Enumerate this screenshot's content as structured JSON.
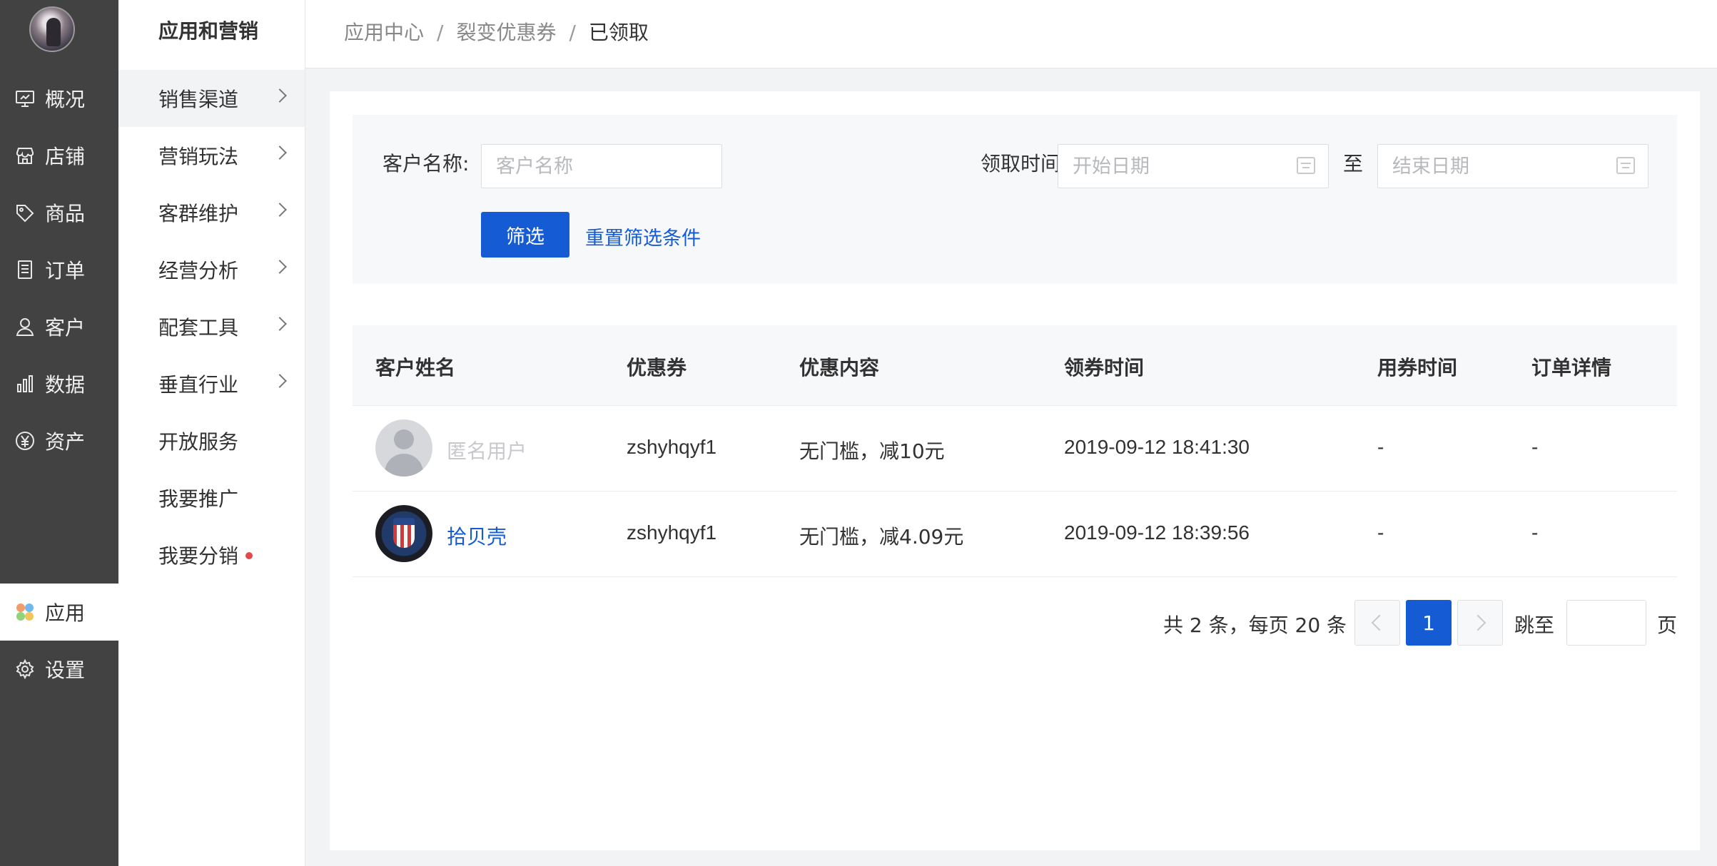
{
  "nav_primary": {
    "items": [
      {
        "label": "概况",
        "icon": "dashboard-icon"
      },
      {
        "label": "店铺",
        "icon": "store-icon"
      },
      {
        "label": "商品",
        "icon": "tag-icon"
      },
      {
        "label": "订单",
        "icon": "order-icon"
      },
      {
        "label": "客户",
        "icon": "user-icon"
      },
      {
        "label": "数据",
        "icon": "bar-chart-icon"
      },
      {
        "label": "资产",
        "icon": "yuan-icon"
      },
      {
        "label": "应用",
        "icon": "apps-icon"
      },
      {
        "label": "设置",
        "icon": "gear-icon"
      }
    ],
    "active": "应用"
  },
  "nav_secondary": {
    "title": "应用和营销",
    "items": [
      {
        "label": "销售渠道",
        "has_children": true
      },
      {
        "label": "营销玩法",
        "has_children": true
      },
      {
        "label": "客群维护",
        "has_children": true
      },
      {
        "label": "经营分析",
        "has_children": true
      },
      {
        "label": "配套工具",
        "has_children": true
      },
      {
        "label": "垂直行业",
        "has_children": true
      },
      {
        "label": "开放服务",
        "has_children": false
      },
      {
        "label": "我要推广",
        "has_children": false
      },
      {
        "label": "我要分销",
        "has_children": false,
        "badge_dot": true
      }
    ]
  },
  "breadcrumb": {
    "items": [
      "应用中心",
      "裂变优惠券",
      "已领取"
    ],
    "separator": "/"
  },
  "filter": {
    "customer_name_label": "客户名称:",
    "customer_name_placeholder": "客户名称",
    "customer_name_value": "",
    "receive_time_label": "领取时间:",
    "start_date_placeholder": "开始日期",
    "end_date_placeholder": "结束日期",
    "to_label": "至",
    "filter_button": "筛选",
    "reset_link": "重置筛选条件"
  },
  "table": {
    "columns": [
      "客户姓名",
      "优惠券",
      "优惠内容",
      "领券时间",
      "用券时间",
      "订单详情"
    ],
    "rows": [
      {
        "name": "匿名用户",
        "anonymous": true,
        "coupon": "zshyhqyf1",
        "content": "无门槛，减10元",
        "receive_time": "2019-09-12 18:41:30",
        "use_time": "-",
        "order_detail": "-"
      },
      {
        "name": "拾贝壳",
        "anonymous": false,
        "coupon": "zshyhqyf1",
        "content": "无门槛，减4.09元",
        "receive_time": "2019-09-12 18:39:56",
        "use_time": "-",
        "order_detail": "-"
      }
    ]
  },
  "pagination": {
    "summary": "共 2 条，每页 20 条",
    "current_page": "1",
    "jump_label": "跳至",
    "page_suffix": "页",
    "jump_value": ""
  },
  "colors": {
    "primary": "#155bd4",
    "sidebar": "#424242",
    "badge": "#e34b4b"
  }
}
